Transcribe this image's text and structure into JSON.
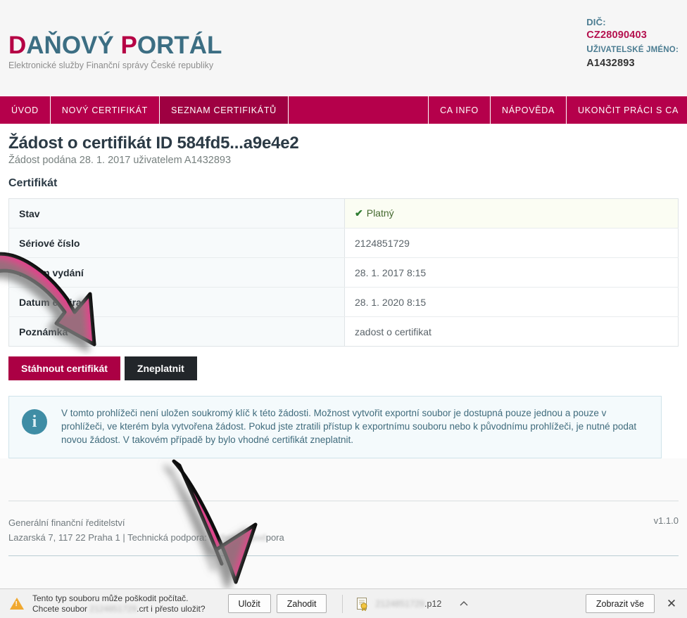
{
  "header": {
    "logo_part1": "D",
    "logo_part2": "AŇOVÝ ",
    "logo_part3": "P",
    "logo_part4": "ORTÁL",
    "logo_subtitle": "Elektronické služby Finanční správy České republiky",
    "dic_label": "DIČ:",
    "dic_value": "CZ28090403",
    "username_label_first": "U",
    "username_label_rest": "ŽIVATELSKÉ JMÉNO:",
    "username_value": "A1432893",
    "brand_accent": "#b5004b",
    "brand_blue": "#3c6e83"
  },
  "nav": {
    "left_items": [
      {
        "label": "ÚVOD",
        "active": false
      },
      {
        "label": "NOVÝ CERTIFIKÁT",
        "active": false
      },
      {
        "label": "SEZNAM CERTIFIKÁTŮ",
        "active": true
      }
    ],
    "right_items": [
      {
        "label": "CA INFO"
      },
      {
        "label": "NÁPOVĚDA"
      },
      {
        "label": "UKONČIT PRÁCI S CA"
      }
    ]
  },
  "main": {
    "page_title": "Žádost o certifikát ID 584fd5...a9e4e2",
    "page_subtitle": "Žádost podána 28. 1. 2017 uživatelem A1432893",
    "section_title": "Certifikát",
    "table": {
      "rows": [
        {
          "label": "Stav",
          "value": "Platný",
          "state": true,
          "check_icon": "✔"
        },
        {
          "label": "Sériové číslo",
          "value": "2124851729",
          "state": false
        },
        {
          "label": "Datum vydání",
          "value": "28. 1. 2017 8:15",
          "state": false
        },
        {
          "label": "Datum expirace",
          "value": "28. 1. 2020 8:15",
          "state": false
        },
        {
          "label": "Poznámka",
          "value": "zadost o certifikat",
          "state": false
        }
      ]
    },
    "buttons": {
      "download_label": "Stáhnout certifikát",
      "revoke_label": "Zneplatnit"
    },
    "infobox": {
      "icon": "info-icon",
      "text": "V tomto prohlížeči není uložen soukromý klíč k této žádosti. Možnost vytvořit exportní soubor je dostupná pouze jednou a pouze v prohlížeči, ve kterém byla vytvořena žádost. Pokud jste ztratili přístup k exportnímu souboru nebo k původnímu prohlížeči, je nutné podat novou žádost. V takovém případě by bylo vhodné certifikát zneplatnit."
    }
  },
  "footer": {
    "line1": "Generální finanční ředitelství",
    "line2_a": "Lazarská 7, 117 22 Praha 1 | Technická podpora: ",
    "line2_blurred": "technicka.pod",
    "line2_b": "pora",
    "version": "v1.1.0"
  },
  "download_bar": {
    "warning_line1": "Tento typ souboru může poškodit počítač.",
    "warning_line2_a": "Chcete soubor ",
    "warning_line2_blurred": "2124851729",
    "warning_line2_b": ".crt i přesto uložit?",
    "save_label": "Uložit",
    "discard_label": "Zahodit",
    "item_name_blurred": "2124851729",
    "item_name_ext": ".p12",
    "show_all_label": "Zobrazit vše",
    "close_label": "✕",
    "chevron": "⌃"
  },
  "annotations": {
    "arrow_color": "#e0408c",
    "arrow1_target": "stahnout-certifikat-button",
    "arrow2_target": "ulozit-button"
  }
}
